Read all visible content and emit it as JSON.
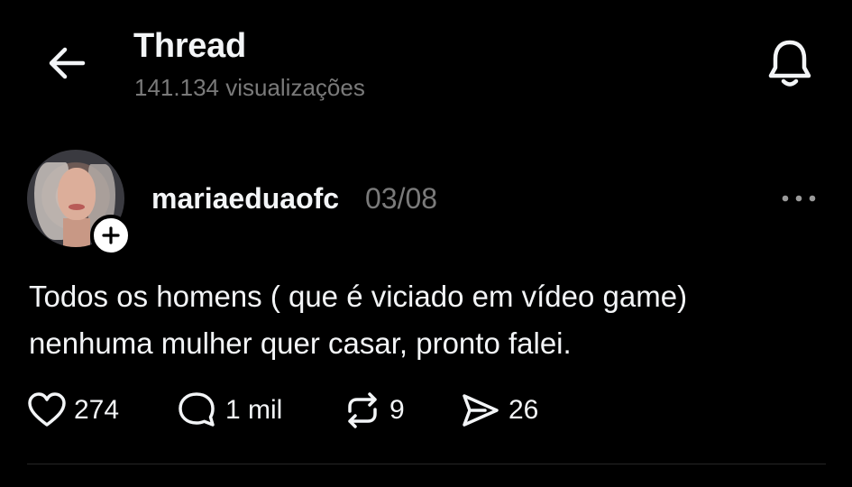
{
  "header": {
    "title": "Thread",
    "subtitle": "141.134 visualizações"
  },
  "post": {
    "username": "mariaeduaofc",
    "date": "03/08",
    "text": "Todos os homens ( que é viciado em vídeo game)\nnenhuma mulher quer casar, pronto falei.",
    "actions": {
      "likes": "274",
      "replies": "1 mil",
      "reposts": "9",
      "shares": "26"
    }
  },
  "icons": {
    "back": "arrow-left-icon",
    "notifications": "bell-icon",
    "follow": "plus-icon",
    "more": "more-horizontal-icon",
    "like": "heart-icon",
    "reply": "comment-icon",
    "repost": "repost-icon",
    "share": "send-icon"
  },
  "colors": {
    "background": "#000000",
    "text_primary": "#f3f5f7",
    "text_secondary": "#7a7a7a",
    "divider": "#262626"
  }
}
